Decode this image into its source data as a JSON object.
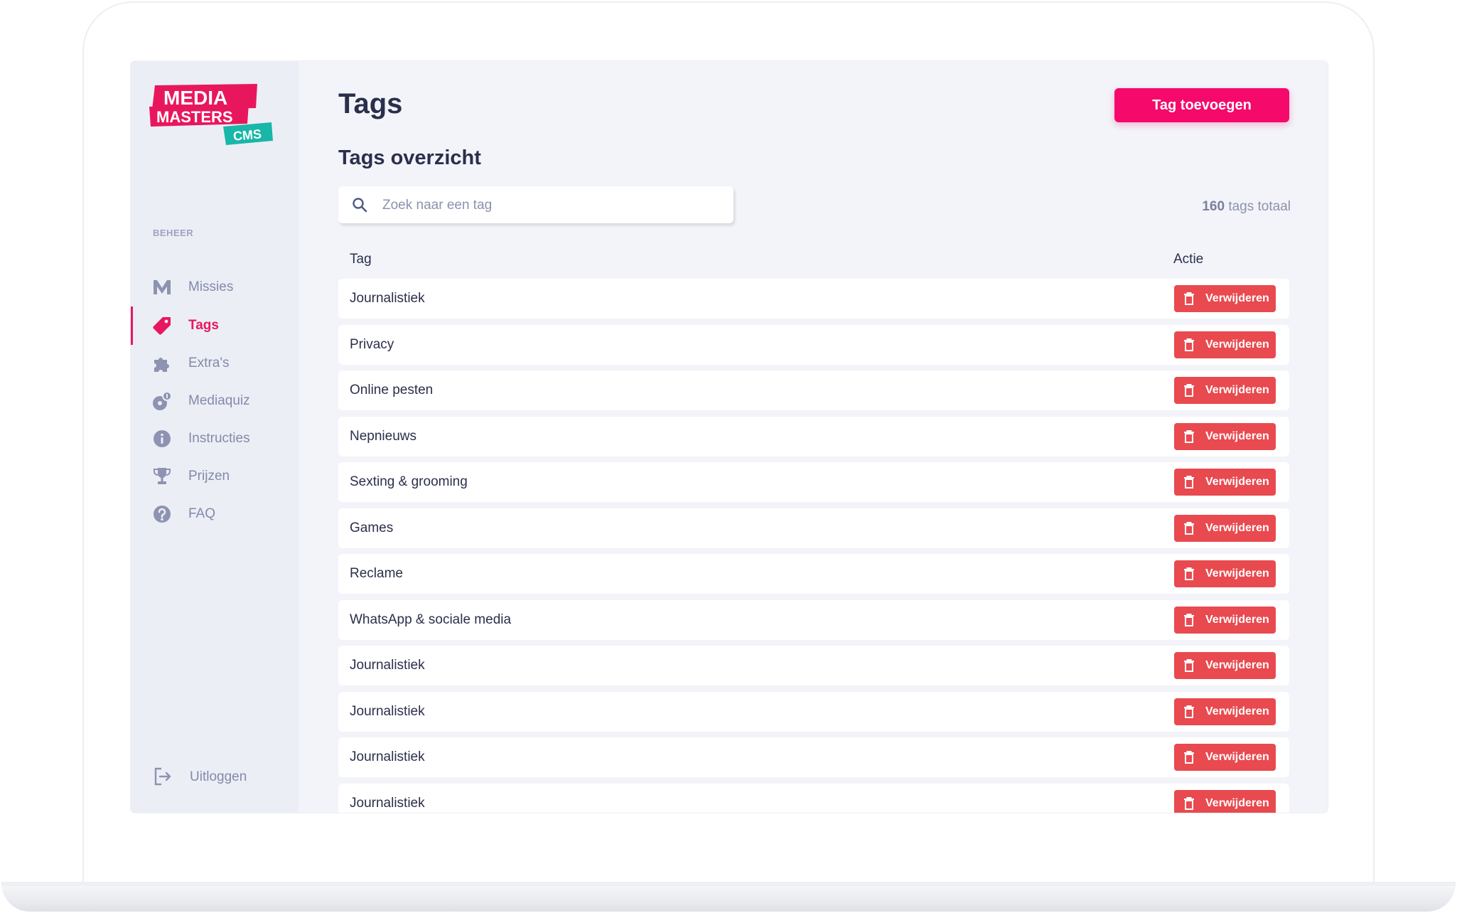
{
  "logo": {
    "line1": "MEDIA",
    "line2": "MASTERS",
    "badge": "CMS"
  },
  "sidebar": {
    "section_label": "BEHEER",
    "items": [
      {
        "label": "Missies",
        "icon": "m-letter-icon",
        "active": false
      },
      {
        "label": "Tags",
        "icon": "tag-icon",
        "active": true
      },
      {
        "label": "Extra's",
        "icon": "puzzle-icon",
        "active": false
      },
      {
        "label": "Mediaquiz",
        "icon": "quiz-icon",
        "active": false
      },
      {
        "label": "Instructies",
        "icon": "info-icon",
        "active": false
      },
      {
        "label": "Prijzen",
        "icon": "trophy-icon",
        "active": false
      },
      {
        "label": "FAQ",
        "icon": "question-icon",
        "active": false
      }
    ],
    "logout_label": "Uitloggen"
  },
  "header": {
    "title": "Tags",
    "add_button": "Tag toevoegen"
  },
  "overview": {
    "title": "Tags overzicht",
    "search_placeholder": "Zoek naar een tag",
    "total_count": "160",
    "total_suffix": "tags totaal"
  },
  "table": {
    "columns": [
      "Tag",
      "Actie"
    ],
    "delete_label": "Verwijderen",
    "rows": [
      "Journalistiek",
      "Privacy",
      "Online pesten",
      "Nepnieuws",
      "Sexting & grooming",
      "Games",
      "Reclame",
      "WhatsApp & sociale media",
      "Journalistiek",
      "Journalistiek",
      "Journalistiek",
      "Journalistiek"
    ]
  },
  "colors": {
    "accent": "#f5096b",
    "delete": "#e84a4f",
    "active_nav": "#e8175d",
    "logo_teal": "#18b7a8"
  }
}
